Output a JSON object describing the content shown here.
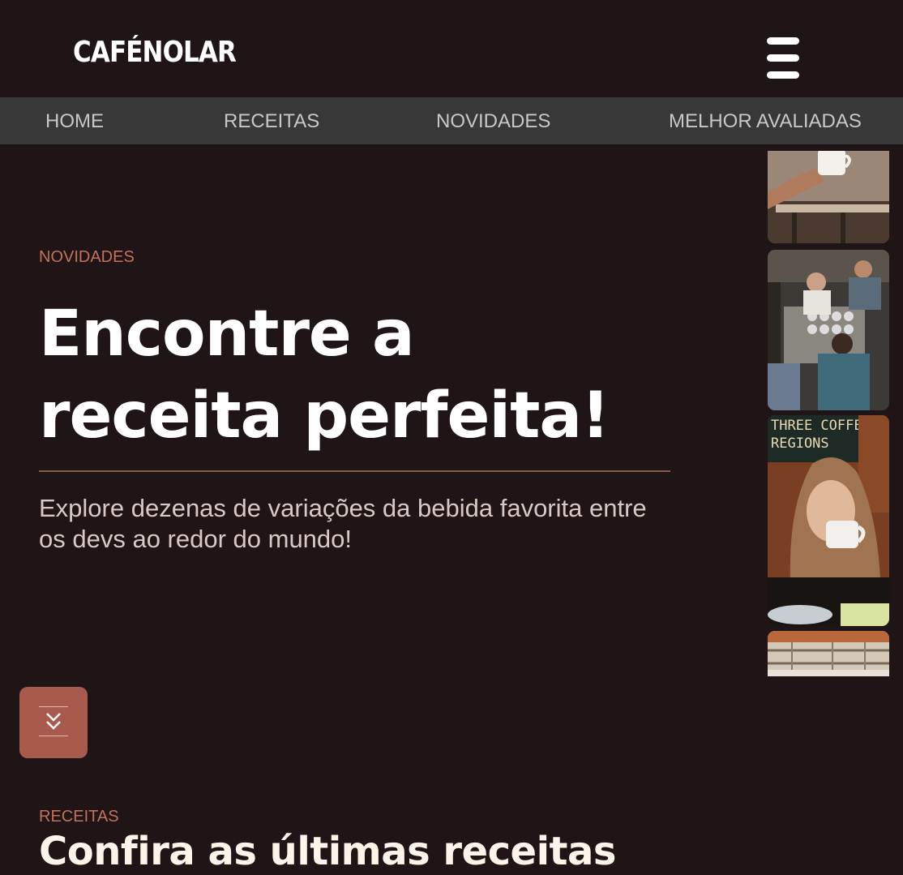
{
  "header": {
    "logo": "CAFÉNOLAR",
    "menu_icon": "hamburger-menu-icon"
  },
  "nav": {
    "items": [
      "HOME",
      "RECEITAS",
      "NOVIDADES",
      "MELHOR AVALIADAS"
    ]
  },
  "hero": {
    "eyebrow": "NOVIDADES",
    "title_line1": "Encontre a",
    "title_line2": "receita perfeita!",
    "description_line1": "Explore dezenas de variações da bebida favorita entre",
    "description_line2": "os devs ao redor do mundo!",
    "gallery": [
      {
        "icon": "coffee-cup-hand-photo"
      },
      {
        "icon": "baristas-photo"
      },
      {
        "icon": "woman-drinking-coffee-photo",
        "sign_text": "THREE COFFEE REGIONS"
      },
      {
        "icon": "cafe-ceiling-photo"
      }
    ]
  },
  "scroll_button": {
    "icon": "double-chevron-down-icon"
  },
  "recipes": {
    "eyebrow": "RECEITAS",
    "title": "Confira as últimas receitas"
  },
  "colors": {
    "background": "#1f1517",
    "navbar": "#383838",
    "accent": "#c4705b",
    "button": "#a85a4c"
  }
}
